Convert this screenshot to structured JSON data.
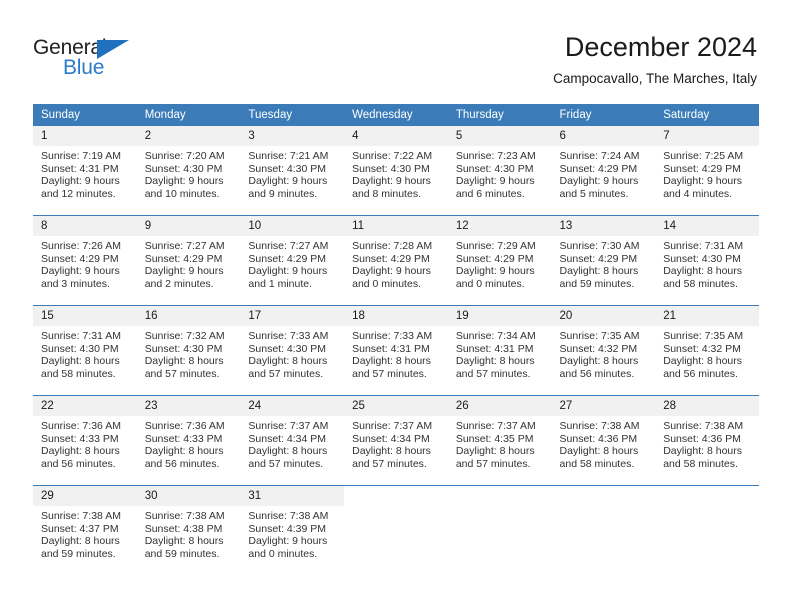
{
  "brand": {
    "name_top": "General",
    "name_bottom": "Blue",
    "triangle_color": "#1f70bd",
    "blue_text_color": "#2a7cc7"
  },
  "header": {
    "title": "December 2024",
    "subtitle": "Campocavallo, The Marches, Italy"
  },
  "theme": {
    "header_bg": "#3b7cb8",
    "daynum_bg": "#f1f1f1",
    "row_divider": "#3b7cb8"
  },
  "weekday_headers": [
    "Sunday",
    "Monday",
    "Tuesday",
    "Wednesday",
    "Thursday",
    "Friday",
    "Saturday"
  ],
  "labels": {
    "sunrise_prefix": "Sunrise: ",
    "sunset_prefix": "Sunset: ",
    "daylight_prefix": "Daylight: "
  },
  "weeks": [
    [
      {
        "day": "1",
        "sunrise": "Sunrise: 7:19 AM",
        "sunset": "Sunset: 4:31 PM",
        "daylight_line1": "Daylight: 9 hours",
        "daylight_line2": "and 12 minutes."
      },
      {
        "day": "2",
        "sunrise": "Sunrise: 7:20 AM",
        "sunset": "Sunset: 4:30 PM",
        "daylight_line1": "Daylight: 9 hours",
        "daylight_line2": "and 10 minutes."
      },
      {
        "day": "3",
        "sunrise": "Sunrise: 7:21 AM",
        "sunset": "Sunset: 4:30 PM",
        "daylight_line1": "Daylight: 9 hours",
        "daylight_line2": "and 9 minutes."
      },
      {
        "day": "4",
        "sunrise": "Sunrise: 7:22 AM",
        "sunset": "Sunset: 4:30 PM",
        "daylight_line1": "Daylight: 9 hours",
        "daylight_line2": "and 8 minutes."
      },
      {
        "day": "5",
        "sunrise": "Sunrise: 7:23 AM",
        "sunset": "Sunset: 4:30 PM",
        "daylight_line1": "Daylight: 9 hours",
        "daylight_line2": "and 6 minutes."
      },
      {
        "day": "6",
        "sunrise": "Sunrise: 7:24 AM",
        "sunset": "Sunset: 4:29 PM",
        "daylight_line1": "Daylight: 9 hours",
        "daylight_line2": "and 5 minutes."
      },
      {
        "day": "7",
        "sunrise": "Sunrise: 7:25 AM",
        "sunset": "Sunset: 4:29 PM",
        "daylight_line1": "Daylight: 9 hours",
        "daylight_line2": "and 4 minutes."
      }
    ],
    [
      {
        "day": "8",
        "sunrise": "Sunrise: 7:26 AM",
        "sunset": "Sunset: 4:29 PM",
        "daylight_line1": "Daylight: 9 hours",
        "daylight_line2": "and 3 minutes."
      },
      {
        "day": "9",
        "sunrise": "Sunrise: 7:27 AM",
        "sunset": "Sunset: 4:29 PM",
        "daylight_line1": "Daylight: 9 hours",
        "daylight_line2": "and 2 minutes."
      },
      {
        "day": "10",
        "sunrise": "Sunrise: 7:27 AM",
        "sunset": "Sunset: 4:29 PM",
        "daylight_line1": "Daylight: 9 hours",
        "daylight_line2": "and 1 minute."
      },
      {
        "day": "11",
        "sunrise": "Sunrise: 7:28 AM",
        "sunset": "Sunset: 4:29 PM",
        "daylight_line1": "Daylight: 9 hours",
        "daylight_line2": "and 0 minutes."
      },
      {
        "day": "12",
        "sunrise": "Sunrise: 7:29 AM",
        "sunset": "Sunset: 4:29 PM",
        "daylight_line1": "Daylight: 9 hours",
        "daylight_line2": "and 0 minutes."
      },
      {
        "day": "13",
        "sunrise": "Sunrise: 7:30 AM",
        "sunset": "Sunset: 4:29 PM",
        "daylight_line1": "Daylight: 8 hours",
        "daylight_line2": "and 59 minutes."
      },
      {
        "day": "14",
        "sunrise": "Sunrise: 7:31 AM",
        "sunset": "Sunset: 4:30 PM",
        "daylight_line1": "Daylight: 8 hours",
        "daylight_line2": "and 58 minutes."
      }
    ],
    [
      {
        "day": "15",
        "sunrise": "Sunrise: 7:31 AM",
        "sunset": "Sunset: 4:30 PM",
        "daylight_line1": "Daylight: 8 hours",
        "daylight_line2": "and 58 minutes."
      },
      {
        "day": "16",
        "sunrise": "Sunrise: 7:32 AM",
        "sunset": "Sunset: 4:30 PM",
        "daylight_line1": "Daylight: 8 hours",
        "daylight_line2": "and 57 minutes."
      },
      {
        "day": "17",
        "sunrise": "Sunrise: 7:33 AM",
        "sunset": "Sunset: 4:30 PM",
        "daylight_line1": "Daylight: 8 hours",
        "daylight_line2": "and 57 minutes."
      },
      {
        "day": "18",
        "sunrise": "Sunrise: 7:33 AM",
        "sunset": "Sunset: 4:31 PM",
        "daylight_line1": "Daylight: 8 hours",
        "daylight_line2": "and 57 minutes."
      },
      {
        "day": "19",
        "sunrise": "Sunrise: 7:34 AM",
        "sunset": "Sunset: 4:31 PM",
        "daylight_line1": "Daylight: 8 hours",
        "daylight_line2": "and 57 minutes."
      },
      {
        "day": "20",
        "sunrise": "Sunrise: 7:35 AM",
        "sunset": "Sunset: 4:32 PM",
        "daylight_line1": "Daylight: 8 hours",
        "daylight_line2": "and 56 minutes."
      },
      {
        "day": "21",
        "sunrise": "Sunrise: 7:35 AM",
        "sunset": "Sunset: 4:32 PM",
        "daylight_line1": "Daylight: 8 hours",
        "daylight_line2": "and 56 minutes."
      }
    ],
    [
      {
        "day": "22",
        "sunrise": "Sunrise: 7:36 AM",
        "sunset": "Sunset: 4:33 PM",
        "daylight_line1": "Daylight: 8 hours",
        "daylight_line2": "and 56 minutes."
      },
      {
        "day": "23",
        "sunrise": "Sunrise: 7:36 AM",
        "sunset": "Sunset: 4:33 PM",
        "daylight_line1": "Daylight: 8 hours",
        "daylight_line2": "and 56 minutes."
      },
      {
        "day": "24",
        "sunrise": "Sunrise: 7:37 AM",
        "sunset": "Sunset: 4:34 PM",
        "daylight_line1": "Daylight: 8 hours",
        "daylight_line2": "and 57 minutes."
      },
      {
        "day": "25",
        "sunrise": "Sunrise: 7:37 AM",
        "sunset": "Sunset: 4:34 PM",
        "daylight_line1": "Daylight: 8 hours",
        "daylight_line2": "and 57 minutes."
      },
      {
        "day": "26",
        "sunrise": "Sunrise: 7:37 AM",
        "sunset": "Sunset: 4:35 PM",
        "daylight_line1": "Daylight: 8 hours",
        "daylight_line2": "and 57 minutes."
      },
      {
        "day": "27",
        "sunrise": "Sunrise: 7:38 AM",
        "sunset": "Sunset: 4:36 PM",
        "daylight_line1": "Daylight: 8 hours",
        "daylight_line2": "and 58 minutes."
      },
      {
        "day": "28",
        "sunrise": "Sunrise: 7:38 AM",
        "sunset": "Sunset: 4:36 PM",
        "daylight_line1": "Daylight: 8 hours",
        "daylight_line2": "and 58 minutes."
      }
    ],
    [
      {
        "day": "29",
        "sunrise": "Sunrise: 7:38 AM",
        "sunset": "Sunset: 4:37 PM",
        "daylight_line1": "Daylight: 8 hours",
        "daylight_line2": "and 59 minutes."
      },
      {
        "day": "30",
        "sunrise": "Sunrise: 7:38 AM",
        "sunset": "Sunset: 4:38 PM",
        "daylight_line1": "Daylight: 8 hours",
        "daylight_line2": "and 59 minutes."
      },
      {
        "day": "31",
        "sunrise": "Sunrise: 7:38 AM",
        "sunset": "Sunset: 4:39 PM",
        "daylight_line1": "Daylight: 9 hours",
        "daylight_line2": "and 0 minutes."
      },
      {
        "day": "",
        "sunrise": "",
        "sunset": "",
        "daylight_line1": "",
        "daylight_line2": ""
      },
      {
        "day": "",
        "sunrise": "",
        "sunset": "",
        "daylight_line1": "",
        "daylight_line2": ""
      },
      {
        "day": "",
        "sunrise": "",
        "sunset": "",
        "daylight_line1": "",
        "daylight_line2": ""
      },
      {
        "day": "",
        "sunrise": "",
        "sunset": "",
        "daylight_line1": "",
        "daylight_line2": ""
      }
    ]
  ]
}
